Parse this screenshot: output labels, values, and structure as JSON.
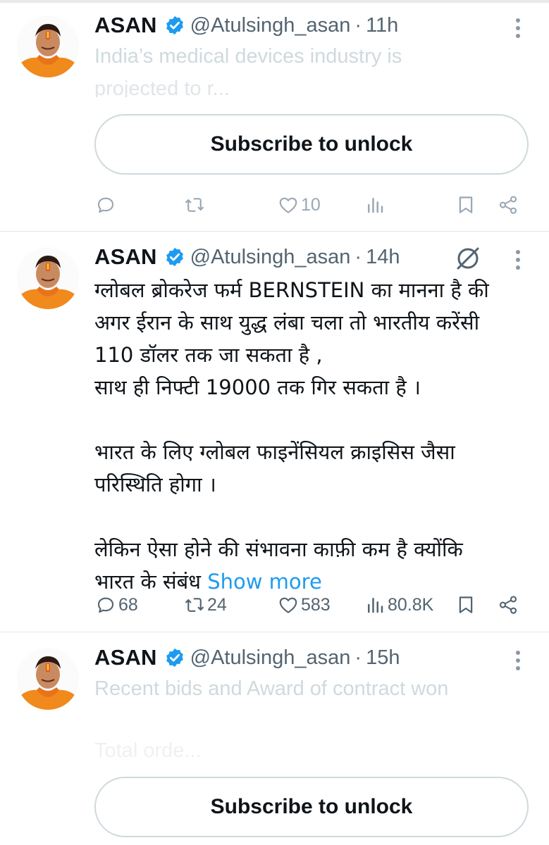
{
  "tweets": [
    {
      "name": "ASAN",
      "handle": "@Atulsingh_asan",
      "separator": "·",
      "time": "11h",
      "preview_lines": [
        "India’s medical devices industry is",
        "projected to r..."
      ],
      "subscribe_label": "Subscribe to unlock",
      "stats": {
        "replies": "",
        "retweets": "",
        "likes": "10",
        "views": ""
      }
    },
    {
      "name": "ASAN",
      "handle": "@Atulsingh_asan",
      "separator": "·",
      "time": "14h",
      "body": {
        "p1": [
          "ग्लोबल ब्रोकरेज फर्म BERNSTEIN का मानना है की",
          "अगर ईरान के साथ युद्ध लंबा चला तो भारतीय करेंसी",
          "110 डॉलर तक जा सकता है ,",
          "साथ ही निफ्टी 19000 तक गिर सकता है ।"
        ],
        "p2": [
          "भारत के लिए ग्लोबल फाइनेंसियल क्राइसिस जैसा",
          "परिस्थिति होगा ।"
        ],
        "p3_line1": "लेकिन ऐसा होने की संभावना काफ़ी कम है क्योंकि",
        "p3_line2": "भारत के संबंध",
        "show_more": "Show more"
      },
      "stats": {
        "replies": "68",
        "retweets": "24",
        "likes": "583",
        "views": "80.8K"
      }
    },
    {
      "name": "ASAN",
      "handle": "@Atulsingh_asan",
      "separator": "·",
      "time": "15h",
      "preview_lines": [
        "Recent bids and Award of contract won",
        "Total orde..."
      ],
      "subscribe_label": "Subscribe to unlock"
    }
  ],
  "icons": [
    "avatar",
    "verified-badge-icon",
    "more-options-icon",
    "grok-icon",
    "reply-icon",
    "retweet-icon",
    "like-icon",
    "views-icon",
    "bookmark-icon",
    "share-icon"
  ],
  "colors": {
    "accent": "#1d9bf0",
    "text": "#0f1419",
    "muted": "#536471",
    "border": "#cfd9de"
  }
}
